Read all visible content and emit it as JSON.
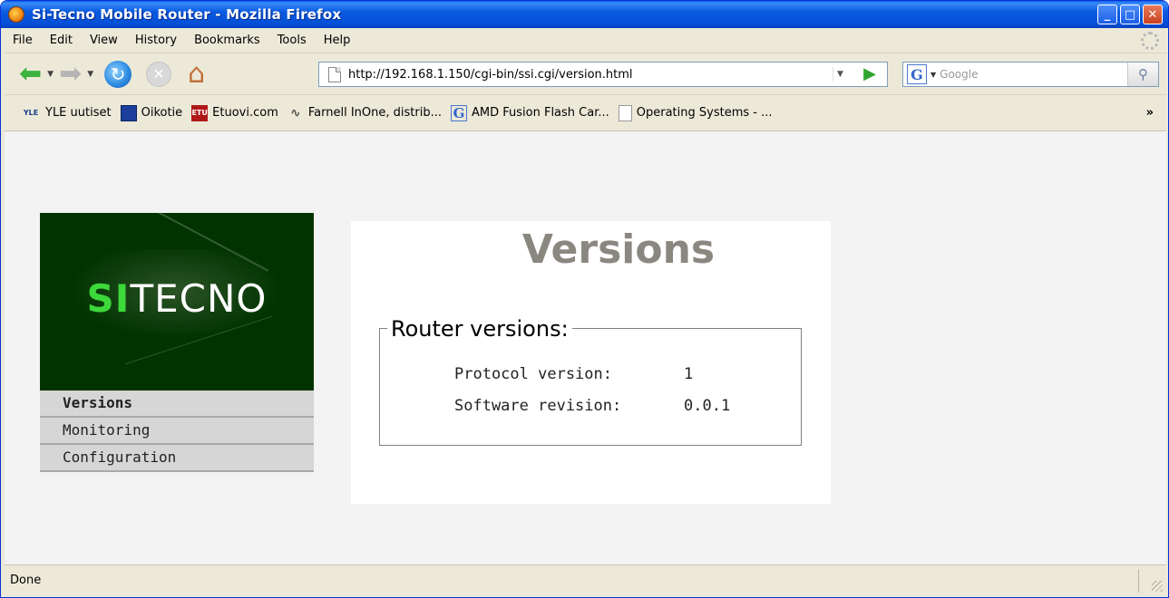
{
  "window": {
    "title": "Si-Tecno Mobile Router - Mozilla Firefox",
    "buttons": {
      "minimize": "_",
      "maximize": "□",
      "close": "✕"
    }
  },
  "menu": {
    "items": [
      "File",
      "Edit",
      "View",
      "History",
      "Bookmarks",
      "Tools",
      "Help"
    ]
  },
  "navigation": {
    "url": "http://192.168.1.150/cgi-bin/ssi.cgi/version.html",
    "search_placeholder": "Google"
  },
  "bookmarks": [
    {
      "label": "YLE uutiset",
      "icon": "yle-icon",
      "icon_text": "YLE"
    },
    {
      "label": "Oikotie",
      "icon": "oikotie-icon",
      "icon_text": ""
    },
    {
      "label": "Etuovi.com",
      "icon": "etuovi-icon",
      "icon_text": "ETU"
    },
    {
      "label": "Farnell InOne, distrib...",
      "icon": "farnell-icon",
      "icon_text": ""
    },
    {
      "label": "AMD Fusion Flash Car...",
      "icon": "google-icon",
      "icon_text": "G"
    },
    {
      "label": "Operating Systems - ...",
      "icon": "page-icon",
      "icon_text": ""
    }
  ],
  "bookmarks_overflow": "»",
  "logo": {
    "accent": "SI",
    "rest": "TECNO",
    "accent_color": "#3dd83a",
    "background": "#003300"
  },
  "sidebar": {
    "items": [
      {
        "label": "Versions",
        "active": true
      },
      {
        "label": "Monitoring",
        "active": false
      },
      {
        "label": "Configuration",
        "active": false
      }
    ]
  },
  "main": {
    "title": "Versions",
    "section": {
      "legend": "Router versions:",
      "rows": [
        {
          "label": "Protocol version:",
          "value": "1"
        },
        {
          "label": "Software revision:",
          "value": "0.0.1"
        }
      ]
    }
  },
  "status": {
    "text": "Done"
  }
}
